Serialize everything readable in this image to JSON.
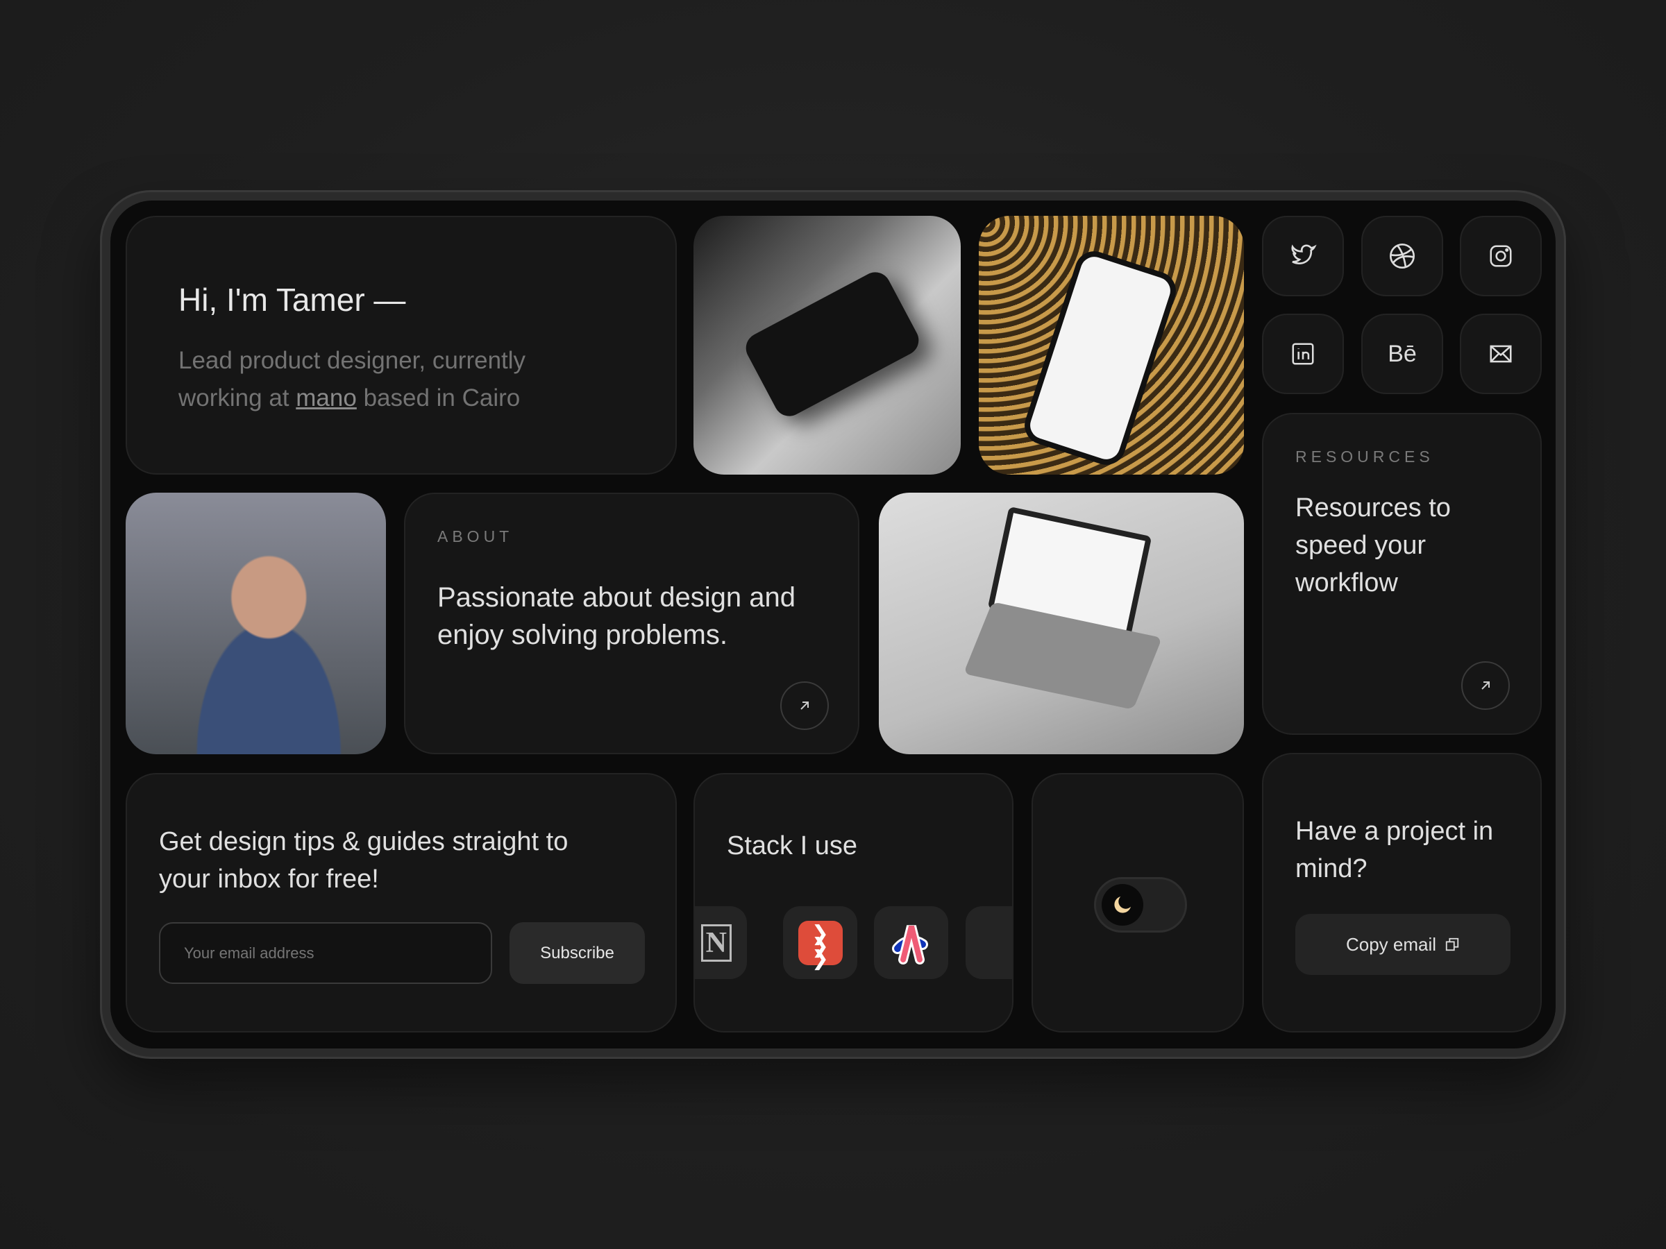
{
  "intro": {
    "greeting": "Hi, I'm Tamer —",
    "line1": "Lead product designer, currently",
    "line2_before": "working at",
    "company_link": "mano",
    "line2_after": "based in Cairo"
  },
  "social": [
    {
      "icon": "twitter-icon"
    },
    {
      "icon": "dribbble-icon"
    },
    {
      "icon": "instagram-icon"
    },
    {
      "icon": "linkedin-icon"
    },
    {
      "icon": "behance-icon",
      "text": "Bē"
    },
    {
      "icon": "mail-icon"
    }
  ],
  "resources": {
    "label": "RESOURCES",
    "title_lines": [
      "Resources to",
      "speed your",
      "workflow"
    ]
  },
  "about": {
    "label": "ABOUT",
    "title_lines": [
      "Passionate about design and",
      "enjoy solving problems."
    ]
  },
  "newsletter": {
    "title_lines": [
      "Get design tips & guides straight to",
      "your inbox for free!"
    ],
    "placeholder": "Your email address",
    "subscribe_label": "Subscribe"
  },
  "stack": {
    "title": "Stack I use",
    "apps": [
      "notion-icon",
      "todoist-icon",
      "app-icon"
    ]
  },
  "theme_toggle": {
    "mode": "dark",
    "accent": "#f4d6a0"
  },
  "project": {
    "title_lines": [
      "Have a project in",
      "mind?"
    ],
    "copy_label": "Copy email"
  }
}
